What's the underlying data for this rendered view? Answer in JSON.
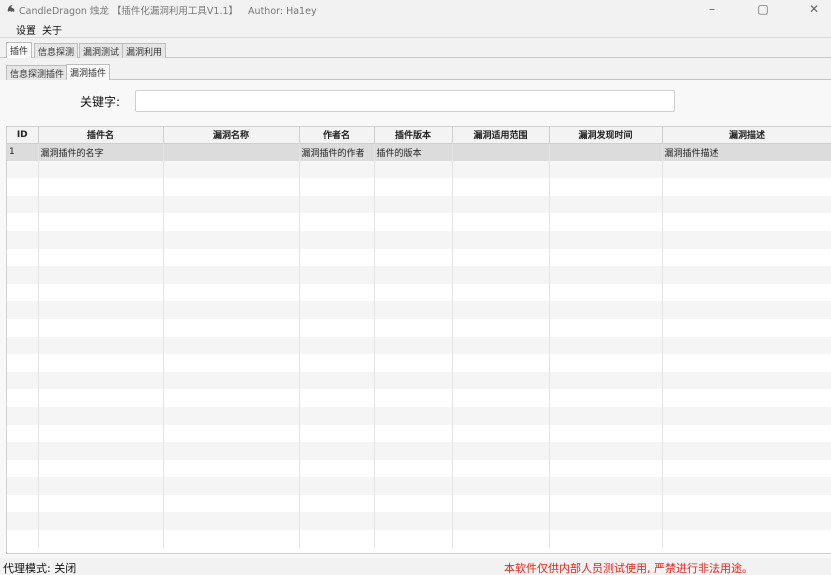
{
  "window": {
    "title": "CandleDragon 烛龙 【插件化漏洞利用工具V1.1】",
    "author": "Author: Ha1ey",
    "minimize_glyph": "–",
    "maximize_glyph": "▢",
    "close_glyph": "✕"
  },
  "menu": [
    "设置",
    "关于"
  ],
  "main_tabs": [
    "插件",
    "信息探测",
    "漏洞测试",
    "漏洞利用"
  ],
  "sub_tabs": [
    "信息探测插件",
    "漏洞插件"
  ],
  "search": {
    "label": "关键字:",
    "value": ""
  },
  "table": {
    "columns": [
      "ID",
      "插件名",
      "漏洞名称",
      "作者名",
      "插件版本",
      "漏洞适用范围",
      "漏洞发现时间",
      "漏洞描述"
    ],
    "rows": [
      [
        "1",
        "漏洞插件的名字",
        "",
        "漏洞插件的作者",
        "插件的版本",
        "",
        "",
        "漏洞插件描述"
      ]
    ],
    "empty_rows": 22
  },
  "status": {
    "proxy": "代理模式: 关闭",
    "warning": "本软件仅供内部人员测试使用, 严禁进行非法用途。"
  },
  "colors": {
    "warning": "#e0261c",
    "selected_row": "#dcdcdc"
  }
}
